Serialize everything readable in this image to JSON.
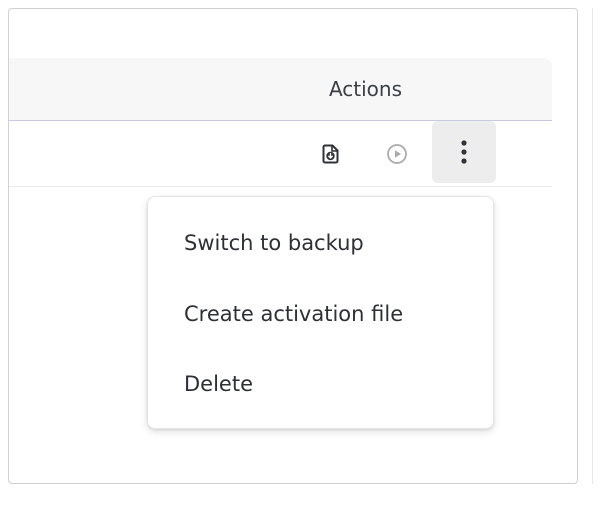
{
  "table": {
    "actions_header": "Actions",
    "row_icons": {
      "download": "download-file-icon",
      "play": "play-circle-icon",
      "more": "more-vertical-icon"
    }
  },
  "menu": {
    "items": [
      {
        "label": "Switch to backup"
      },
      {
        "label": "Create activation file"
      },
      {
        "label": "Delete"
      }
    ]
  },
  "colors": {
    "header_bg": "#f7f7f8",
    "header_border": "#c7c9e6",
    "icon_dark": "#2f3237",
    "icon_light": "#a9abb0",
    "kebab_bg": "#ededee"
  }
}
